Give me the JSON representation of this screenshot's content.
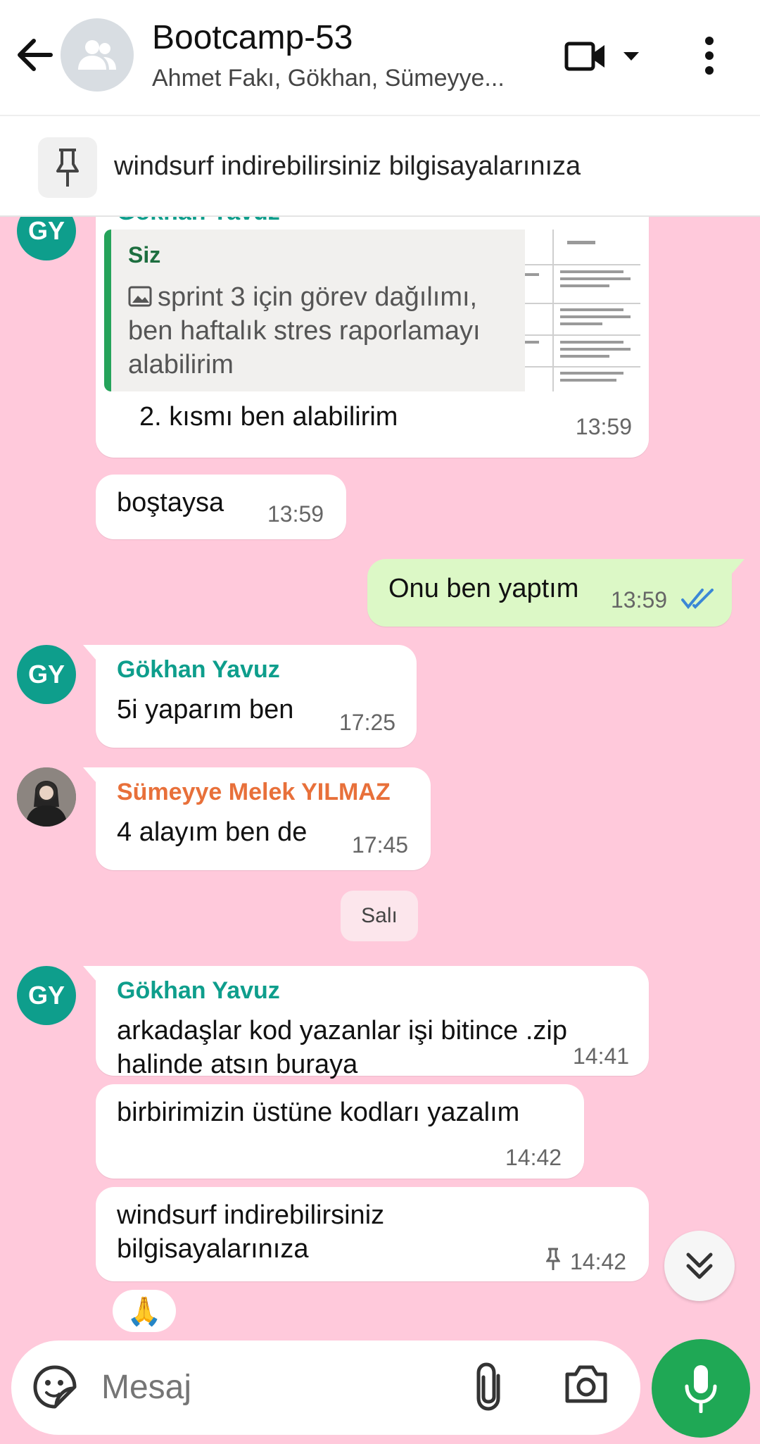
{
  "header": {
    "title": "Bootcamp-53",
    "subtitle": "Ahmet Fakı, Gökhan, Sümeyye..."
  },
  "pinned": {
    "text": "windsurf indirebilirsiniz bilgisayalarınıza"
  },
  "colors": {
    "accent_green": "#1fa855",
    "sender_teal": "#0e9e8c",
    "sender_orange": "#e8703a",
    "wallpaper": "#ffc9db"
  },
  "messages": [
    {
      "sender": "Gökhan Yavuz",
      "avatar": "GY",
      "quote_author": "Siz",
      "quote_text": "sprint 3 için görev dağılımı, ben haftalık stres raporlamayı alabilirim",
      "text": "2. kısmı ben alabilirim",
      "time": "13:59"
    },
    {
      "text": "boştaysa",
      "time": "13:59"
    },
    {
      "text": "Onu ben yaptım",
      "time": "13:59"
    },
    {
      "sender": "Gökhan Yavuz",
      "avatar": "GY",
      "text": "5i yaparım ben",
      "time": "17:25"
    },
    {
      "sender": "Sümeyye Melek YILMAZ",
      "text": "4 alayım ben de",
      "time": "17:45"
    },
    {
      "sender": "Gökhan Yavuz",
      "avatar": "GY",
      "text": "arkadaşlar kod yazanlar işi bitince .zip halinde atsın buraya",
      "time": "14:41"
    },
    {
      "text": "birbirimizin üstüne kodları yazalım",
      "time": "14:42"
    },
    {
      "text": "windsurf indirebilirsiniz bilgisayalarınıza",
      "time": "14:42"
    }
  ],
  "day_separator": "Salı",
  "reaction": "🙏",
  "input": {
    "placeholder": "Mesaj"
  }
}
